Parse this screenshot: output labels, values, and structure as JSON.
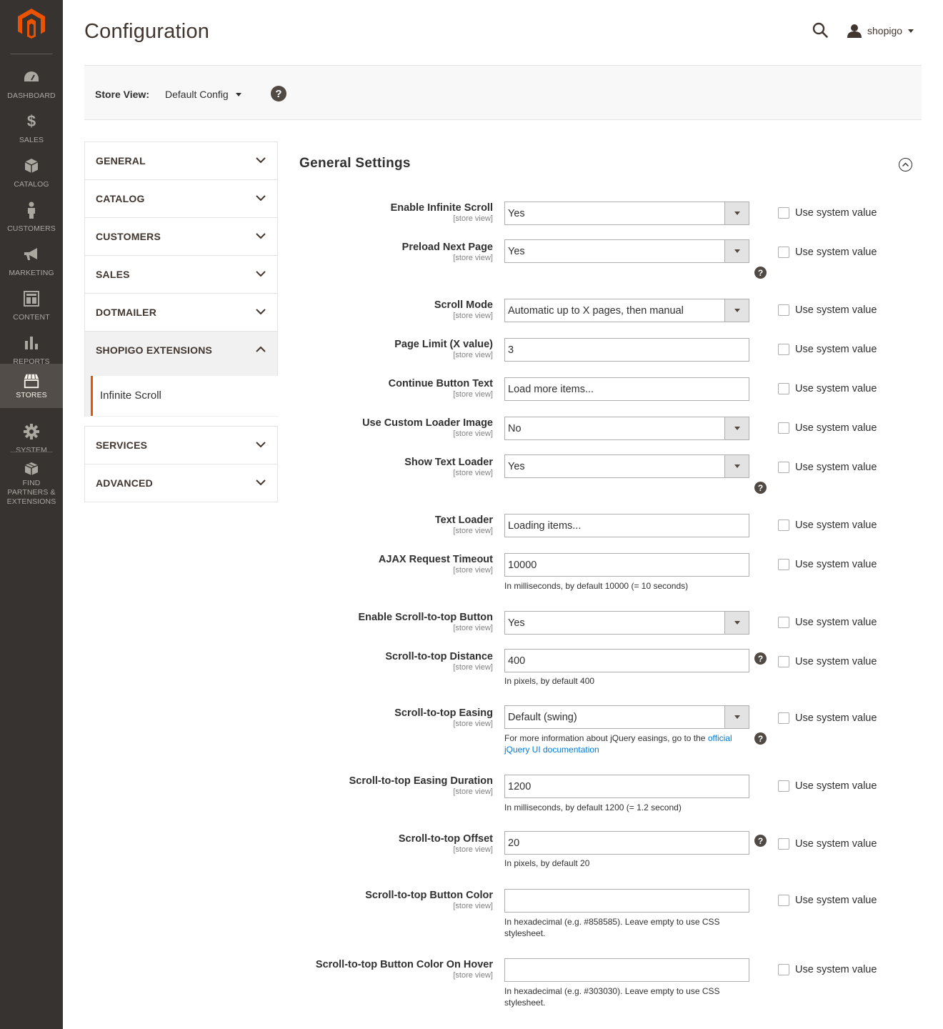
{
  "sidebar": {
    "items": [
      {
        "label": "DASHBOARD",
        "icon": "dashboard-icon"
      },
      {
        "label": "SALES",
        "icon": "dollar-icon"
      },
      {
        "label": "CATALOG",
        "icon": "box-icon"
      },
      {
        "label": "CUSTOMERS",
        "icon": "person-icon"
      },
      {
        "label": "MARKETING",
        "icon": "megaphone-icon"
      },
      {
        "label": "CONTENT",
        "icon": "layout-icon"
      },
      {
        "label": "REPORTS",
        "icon": "bar-chart-icon"
      },
      {
        "label": "STORES",
        "icon": "store-icon"
      },
      {
        "label": "SYSTEM",
        "icon": "gear-icon"
      },
      {
        "label": "FIND PARTNERS & EXTENSIONS",
        "icon": "cubes-icon"
      }
    ]
  },
  "header": {
    "title": "Configuration",
    "user": "shopigo"
  },
  "store_view": {
    "label": "Store View:",
    "value": "Default Config",
    "help": "?"
  },
  "accordion": {
    "items": [
      {
        "label": "GENERAL"
      },
      {
        "label": "CATALOG"
      },
      {
        "label": "CUSTOMERS"
      },
      {
        "label": "SALES"
      },
      {
        "label": "DOTMAILER"
      },
      {
        "label": "SHOPIGO EXTENSIONS"
      },
      {
        "label": "SERVICES"
      },
      {
        "label": "ADVANCED"
      }
    ],
    "sub_item": "Infinite Scroll"
  },
  "section": {
    "title": "General Settings"
  },
  "fields": [
    {
      "label": "Enable Infinite Scroll",
      "scope": "[store view]",
      "value": "Yes",
      "type": "select"
    },
    {
      "label": "Preload Next Page",
      "scope": "[store view]",
      "value": "Yes",
      "type": "select"
    },
    {
      "label": "Scroll Mode",
      "scope": "[store view]",
      "value": "Automatic up to X pages, then manual",
      "type": "select"
    },
    {
      "label": "Page Limit (X value)",
      "scope": "[store view]",
      "value": "3",
      "type": "text"
    },
    {
      "label": "Continue Button Text",
      "scope": "[store view]",
      "value": "Load more items...",
      "type": "text"
    },
    {
      "label": "Use Custom Loader Image",
      "scope": "[store view]",
      "value": "No",
      "type": "select"
    },
    {
      "label": "Show Text Loader",
      "scope": "[store view]",
      "value": "Yes",
      "type": "select"
    },
    {
      "label": "Text Loader",
      "scope": "[store view]",
      "value": "Loading items...",
      "type": "text"
    },
    {
      "label": "AJAX Request Timeout",
      "scope": "[store view]",
      "value": "10000",
      "type": "text",
      "note": "In milliseconds, by default 10000 (= 10 seconds)"
    },
    {
      "label": "Enable Scroll-to-top Button",
      "scope": "[store view]",
      "value": "Yes",
      "type": "select"
    },
    {
      "label": "Scroll-to-top Distance",
      "scope": "[store view]",
      "value": "400",
      "type": "text",
      "note": "In pixels, by default 400"
    },
    {
      "label": "Scroll-to-top Easing",
      "scope": "[store view]",
      "value": "Default (swing)",
      "type": "select",
      "note": "For more information about jQuery easings, go to the ",
      "note_link": "official jQuery UI documentation"
    },
    {
      "label": "Scroll-to-top Easing Duration",
      "scope": "[store view]",
      "value": "1200",
      "type": "text",
      "note": "In milliseconds, by default 1200 (= 1.2 second)"
    },
    {
      "label": "Scroll-to-top Offset",
      "scope": "[store view]",
      "value": "20",
      "type": "text",
      "note": "In pixels, by default 20"
    },
    {
      "label": "Scroll-to-top Button Color",
      "scope": "[store view]",
      "value": "",
      "type": "text",
      "note": "In hexadecimal (e.g. #858585). Leave empty to use CSS stylesheet."
    },
    {
      "label": "Scroll-to-top Button Color On Hover",
      "scope": "[store view]",
      "value": "",
      "type": "text",
      "note": "In hexadecimal (e.g. #303030). Leave empty to use CSS stylesheet."
    }
  ],
  "use_system_value_label": "Use system value",
  "help_glyph": "?",
  "colors": {
    "sidebar_bg": "#373330",
    "sidebar_active": "#524d49",
    "accent": "#eb5202",
    "link": "#007bdb"
  }
}
